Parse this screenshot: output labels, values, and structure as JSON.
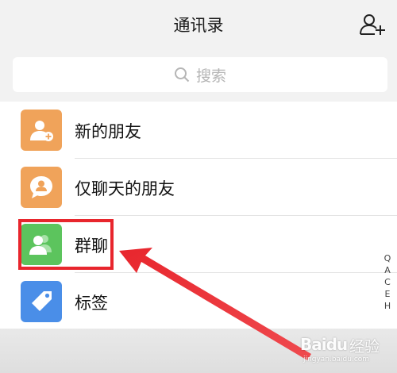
{
  "header": {
    "title": "通讯录",
    "add_icon": "add-contact-icon"
  },
  "search": {
    "placeholder": "搜索",
    "icon": "search-icon"
  },
  "contacts": {
    "items": [
      {
        "label": "新的朋友",
        "icon": "new-friend-icon",
        "color": "#f0a35a"
      },
      {
        "label": "仅聊天的朋友",
        "icon": "chat-only-icon",
        "color": "#f0a35a"
      },
      {
        "label": "群聊",
        "icon": "group-chat-icon",
        "color": "#5cc45d"
      },
      {
        "label": "标签",
        "icon": "tag-icon",
        "color": "#4a8ee8"
      }
    ]
  },
  "index_letters": [
    "Q",
    "A",
    "C",
    "E",
    "H"
  ],
  "annotation": {
    "highlight_color": "#e8262d",
    "highlighted_item": "群聊"
  },
  "watermark": {
    "brand": "Baidu",
    "suffix": "经验",
    "url": "jingyan.baidu.com"
  }
}
